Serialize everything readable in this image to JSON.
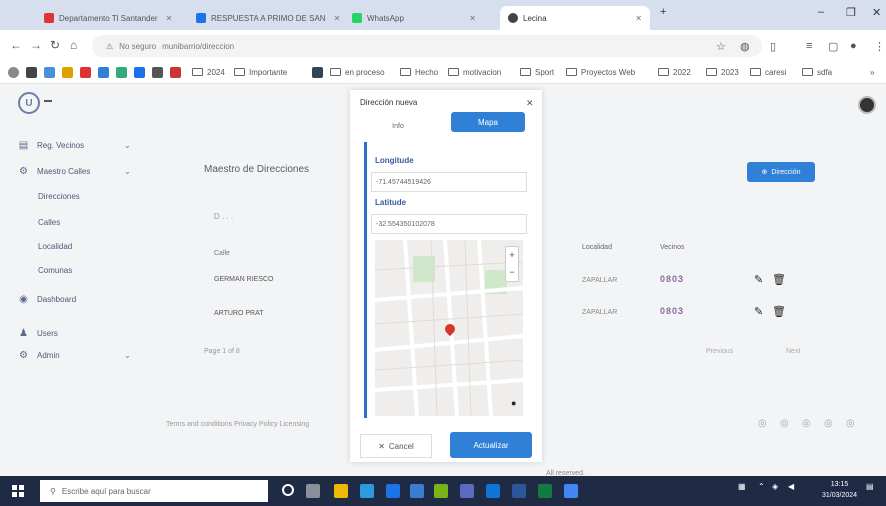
{
  "browser": {
    "tabs": [
      {
        "label": "Departamento Tl Santander",
        "icon_color": "#d33"
      },
      {
        "label": "RESPUESTA A PRIMO DE SAN",
        "icon_color": "#1a73e8"
      },
      {
        "label": "WhatsApp",
        "icon_color": "#25d366"
      },
      {
        "label": "Lecina",
        "icon_color": "#444"
      }
    ],
    "security_label": "No seguro",
    "url": "munibarrio/direccion",
    "bookmarks": [
      "2024",
      "Importante",
      "en proceso",
      "Hecho",
      "motivacion",
      "Sport",
      "Proyectos Web",
      "2022",
      "2023",
      "caresi",
      "sdfa"
    ]
  },
  "sidebar": {
    "items": [
      {
        "label": "Reg. Vecinos",
        "icon": "id-card-icon"
      },
      {
        "label": "Maestro Calles",
        "icon": "sitemap-icon"
      }
    ],
    "subitems": [
      "Direcciones",
      "Calles",
      "Localidad",
      "Comunas"
    ],
    "bottom_items": [
      {
        "label": "Dashboard",
        "icon": "dashboard-icon"
      },
      {
        "label": "Users",
        "icon": "users-icon"
      },
      {
        "label": "Admin",
        "icon": "admin-icon"
      }
    ]
  },
  "main": {
    "title": "Maestro de Direcciones",
    "search_text": "D . . .",
    "column_header": "Calle",
    "rows": [
      "GERMAN RIESCO",
      "ARTURO PRAT"
    ],
    "pager": "Page 1 of 8",
    "footer_links": "Terms and conditions    Privacy Policy    Licensing",
    "add_button_label": "Dirección",
    "right_headers": [
      "Localidad",
      "Vecinos"
    ],
    "right_rows": [
      {
        "localidad": "ZAPALLAR",
        "badge": "0803"
      },
      {
        "localidad": "ZAPALLAR",
        "badge": "0803"
      }
    ],
    "right_pager": [
      "Previous",
      "Next"
    ],
    "rights_text": "All reserved."
  },
  "modal": {
    "title": "Dirección nueva",
    "tabs": [
      "Info",
      "Mapa"
    ],
    "longitud_label": "Longitude",
    "longitud_value": "-71.45744519426",
    "latitud_label": "Latitude",
    "latitud_value": "-32.554350102078",
    "cancel_label": "Cancel",
    "update_label": "Actualizar"
  },
  "taskbar": {
    "search_placeholder": "Escribe aquí para buscar",
    "time": "13:15",
    "date": "31/03/2024"
  },
  "colors": {
    "accent": "#2f80d6",
    "sidebar_text": "#4b5a7a",
    "taskbar": "#1f2a44",
    "map_pin": "#d9342b"
  }
}
